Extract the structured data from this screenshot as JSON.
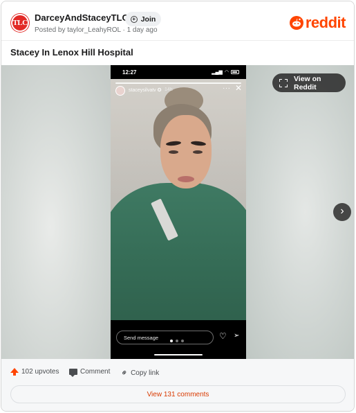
{
  "post": {
    "subreddit": "DarceyAndStaceyTLC",
    "subreddit_avatar_text": "TLC",
    "posted_by": "Posted by taylor_LeahyROL · 1 day ago",
    "join_label": "Join",
    "brand": "reddit",
    "title": "Stacey In Lenox Hill Hospital"
  },
  "media": {
    "view_on_reddit": "View on Reddit",
    "phone": {
      "time": "12:27",
      "story_user": "staceysilvatv ✪",
      "story_time": "14h",
      "message_placeholder": "Send message"
    },
    "carousel": {
      "slides": 3,
      "active_index": 0
    }
  },
  "actions": {
    "upvotes": "102 upvotes",
    "comment": "Comment",
    "copy_link": "Copy link",
    "view_comments": "View 131 comments"
  },
  "colors": {
    "brand_orange": "#ff4500",
    "link_orange": "#d93a00",
    "tlc_red": "#e22a26",
    "gown_green": "#3f7a63"
  }
}
